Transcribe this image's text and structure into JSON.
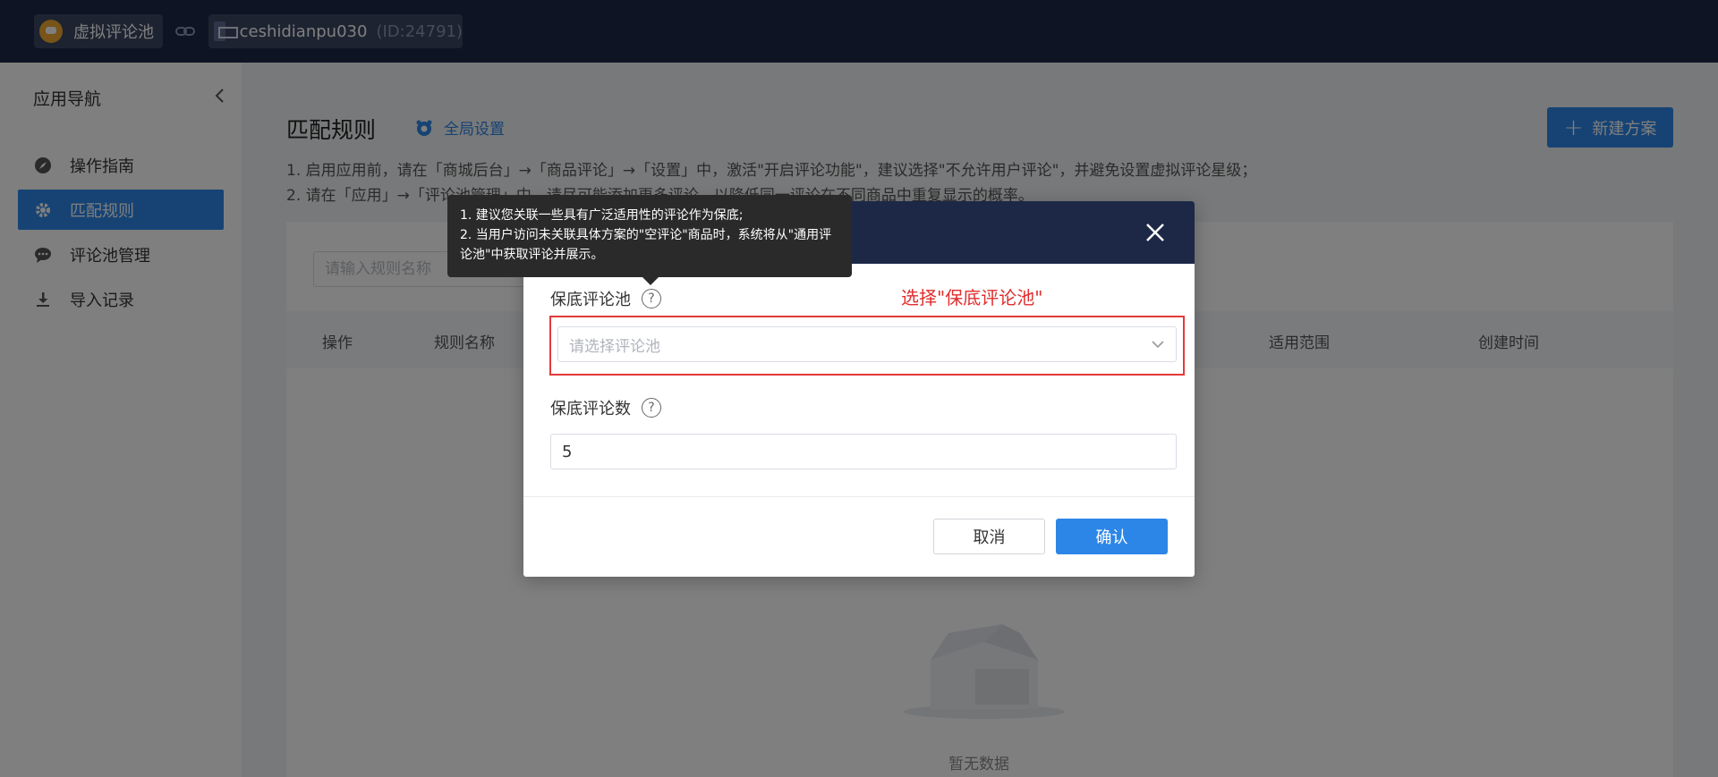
{
  "topbar": {
    "app_name": "虚拟评论池",
    "shop_name": "ceshidianpu030",
    "shop_id": "(ID:24791)"
  },
  "sidebar": {
    "title": "应用导航",
    "items": [
      {
        "label": "操作指南",
        "icon": "compass-icon"
      },
      {
        "label": "匹配规则",
        "icon": "gear-icon",
        "active": true
      },
      {
        "label": "评论池管理",
        "icon": "comment-icon"
      },
      {
        "label": "导入记录",
        "icon": "download-icon"
      }
    ]
  },
  "main": {
    "title": "匹配规则",
    "global_settings": "全局设置",
    "new_button": "新建方案",
    "tips": [
      "1. 启用应用前，请在「商城后台」→「商品评论」→「设置」中，激活\"开启评论功能\"，建议选择\"不允许用户评论\"，并避免设置虚拟评论星级；",
      "2. 请在「应用」→「评论池管理」中，请尽可能添加更多评论，以降低同一评论在不同商品中重复显示的概率。"
    ],
    "search_placeholder": "请输入规则名称",
    "table_headers": [
      "操作",
      "规则名称",
      "适用范围",
      "创建时间"
    ],
    "empty_text": "暂无数据"
  },
  "modal": {
    "pool_label": "保底评论池",
    "pool_placeholder": "请选择评论池",
    "hint": "选择\"保底评论池\"",
    "count_label": "保底评论数",
    "count_value": "5",
    "cancel": "取消",
    "confirm": "确认"
  },
  "tooltip": {
    "line1": "1. 建议您关联一些具有广泛适用性的评论作为保底;",
    "line2": "2. 当用户访问未关联具体方案的\"空评论\"商品时，系统将从\"通用评论池\"中获取评论并展示。"
  },
  "colors": {
    "topbar": "#1c2846",
    "accent": "#2c86e8",
    "highlight": "#e23a3a"
  }
}
